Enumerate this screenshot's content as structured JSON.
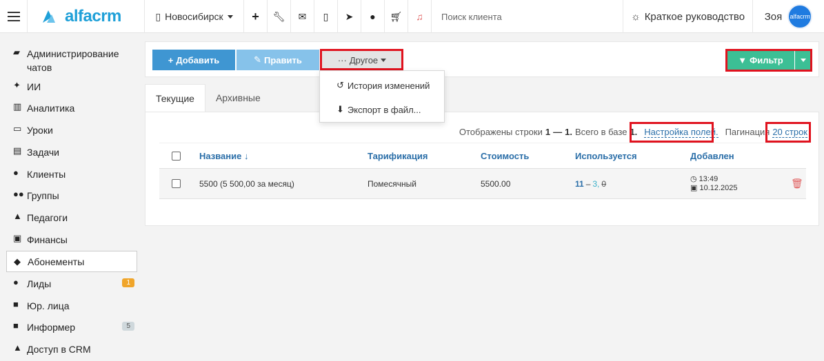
{
  "header": {
    "logo_text": "alfacrm",
    "branch": "Новосибирск",
    "search_placeholder": "Поиск клиента",
    "guide": "Краткое руководство",
    "user_name": "Зоя",
    "avatar_text": "alfacrm",
    "icons": [
      "menu-icon",
      "branch-icon",
      "plus-icon",
      "wrench-icon",
      "envelope-icon",
      "phone-icon",
      "telegram-icon",
      "chat-icon",
      "cart-icon",
      "bell-icon",
      "lightbulb-icon"
    ]
  },
  "sidebar": {
    "items": [
      {
        "label": "Администрирование чатов",
        "icon": "📖"
      },
      {
        "label": "ИИ",
        "icon": "✦"
      },
      {
        "label": "Аналитика",
        "icon": "🗺"
      },
      {
        "label": "Уроки",
        "icon": "▭"
      },
      {
        "label": "Задачи",
        "icon": "▤"
      },
      {
        "label": "Клиенты",
        "icon": "●"
      },
      {
        "label": "Группы",
        "icon": "●"
      },
      {
        "label": "Педагоги",
        "icon": "▲"
      },
      {
        "label": "Финансы",
        "icon": "▣"
      },
      {
        "label": "Абонементы",
        "icon": "◆"
      },
      {
        "label": "Лиды",
        "icon": "●",
        "badge": "1"
      },
      {
        "label": "Юр. лица",
        "icon": "■"
      },
      {
        "label": "Информер",
        "icon": "■",
        "badge": "5"
      },
      {
        "label": "Доступ в CRM",
        "icon": "▲"
      }
    ],
    "active_index": 9
  },
  "toolbar": {
    "add_label": "Добавить",
    "edit_label": "Править",
    "other_label": "Другое",
    "filter_label": "Фильтр"
  },
  "dropdown": {
    "history": "История изменений",
    "export": "Экспорт в файл..."
  },
  "tabs": {
    "current": "Текущие",
    "archive": "Архивные"
  },
  "info": {
    "shown_prefix": "Отображены строки",
    "from": "1",
    "dash": "—",
    "to": "1.",
    "total_prefix": "Всего в базе",
    "total": "1.",
    "fields_link": "Настройка полей.",
    "pagination_label": "Пагинация",
    "pagination_link": "20 строк"
  },
  "table": {
    "headers": [
      "Название ↓",
      "Тарификация",
      "Стоимость",
      "Используется",
      "Добавлен"
    ],
    "rows": [
      {
        "name": "5500 (5 500,00 за месяц)",
        "tarif": "Помесячный",
        "cost": "5500.00",
        "used_a": "11",
        "used_sep": "–",
        "used_b": "3,",
        "used_c": "0",
        "time": "13:49",
        "date": "10.12.2025"
      }
    ]
  },
  "colors": {
    "add": "#3f96d2",
    "edit": "#86c2ea",
    "filter": "#3cbf95",
    "highlight": "#e0121e",
    "link": "#2a6ea8"
  }
}
